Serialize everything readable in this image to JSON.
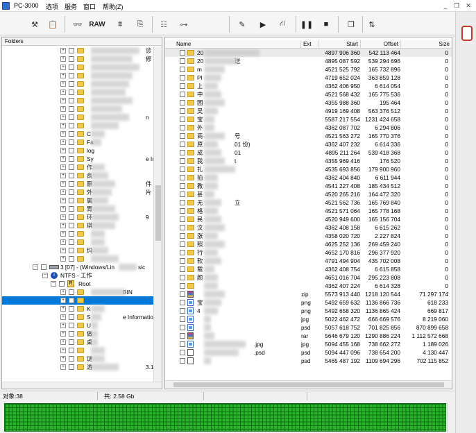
{
  "app": {
    "title": "PC-3000"
  },
  "menu": [
    "选项",
    "服务",
    "窗口",
    "帮助(Z)"
  ],
  "toolbar": {
    "raw_label": "RAW",
    "icons": [
      "tools-icon",
      "clipboard-icon",
      "binoculars-icon",
      "raw-button",
      "stack-icon",
      "export-icon",
      "tree-icon",
      "tree-branch-icon",
      "document-icon",
      "play-icon",
      "network-icon",
      "pause-icon",
      "stop-icon",
      "pages-icon",
      "sort-icon"
    ]
  },
  "left": {
    "header": "Folders",
    "tree": [
      {
        "label": "",
        "suffix": "诊"
      },
      {
        "label": "",
        "suffix": "修"
      },
      {
        "label": "",
        "suffix": ""
      },
      {
        "label": "",
        "suffix": ""
      },
      {
        "label": "",
        "suffix": ""
      },
      {
        "label": "",
        "suffix": ""
      },
      {
        "label": "",
        "suffix": ""
      },
      {
        "label": "",
        "suffix": ""
      },
      {
        "label": "",
        "suffix": "n"
      },
      {
        "label": "",
        "suffix": ""
      },
      {
        "label": "C",
        "suffix": ""
      },
      {
        "label": "Fa",
        "suffix": ""
      },
      {
        "label": "log",
        "suffix": ""
      },
      {
        "label": "Sy",
        "suffix": "e Information"
      },
      {
        "label": "作",
        "suffix": ""
      },
      {
        "label": "俞",
        "suffix": ""
      },
      {
        "label": "原",
        "suffix": "件"
      },
      {
        "label": "外",
        "suffix": "片"
      },
      {
        "label": "属",
        "suffix": ""
      },
      {
        "label": "胃",
        "suffix": ""
      },
      {
        "label": "环",
        "suffix": "9"
      },
      {
        "label": "琪",
        "suffix": ""
      },
      {
        "label": "",
        "suffix": ""
      },
      {
        "label": "",
        "suffix": ""
      },
      {
        "label": "玛",
        "suffix": ""
      },
      {
        "label": "",
        "suffix": ""
      }
    ],
    "partition": "3 [07] - (Windows/Lin",
    "partition_suffix": "sic",
    "fs": "NTFS - 工作",
    "root": "Root",
    "root_icon_letter": "R",
    "after_root": [
      {
        "label": "",
        "suffix": "BIN"
      },
      {
        "label": "",
        "suffix": ""
      },
      {
        "label": "K",
        "suffix": ""
      },
      {
        "label": "S",
        "suffix": "e Information"
      },
      {
        "label": "U",
        "suffix": ""
      },
      {
        "label": "做",
        "suffix": ""
      },
      {
        "label": "桌",
        "suffix": ""
      },
      {
        "label": "",
        "suffix": ""
      },
      {
        "label": "谜",
        "suffix": ""
      },
      {
        "label": "游",
        "suffix": "3.1"
      }
    ]
  },
  "right": {
    "columns": {
      "name": "Name",
      "ext": "Ext",
      "start": "Start",
      "offset": "Offset",
      "size": "Size"
    },
    "rows": [
      {
        "icon": "folder",
        "name": "20",
        "ext": "",
        "start": "4897 906 360",
        "offset": "542 113 464",
        "size": "0"
      },
      {
        "icon": "folder",
        "name": "20",
        "ext": "",
        "start": "4895 087 592",
        "offset": "539 294 696",
        "size": "0",
        "suffix": "送"
      },
      {
        "icon": "folder",
        "name": "m",
        "ext": "",
        "start": "4521 525 792",
        "offset": "165 732 896",
        "size": "0"
      },
      {
        "icon": "folder",
        "name": "Pl",
        "ext": "",
        "start": "4719 652 024",
        "offset": "363 859 128",
        "size": "0"
      },
      {
        "icon": "folder",
        "name": "上",
        "ext": "",
        "start": "4362 406 950",
        "offset": "6 614 054",
        "size": "0"
      },
      {
        "icon": "folder",
        "name": "中",
        "ext": "",
        "start": "4521 568 432",
        "offset": "165 775 536",
        "size": "0"
      },
      {
        "icon": "folder",
        "name": "困",
        "ext": "",
        "start": "4355 988 360",
        "offset": "195 464",
        "size": "0"
      },
      {
        "icon": "folder",
        "name": "吴",
        "ext": "",
        "start": "4919 169 408",
        "offset": "563 376 512",
        "size": "0"
      },
      {
        "icon": "folder",
        "name": "宝",
        "ext": "",
        "start": "5587 217 554",
        "offset": "1231 424 658",
        "size": "0"
      },
      {
        "icon": "folder",
        "name": "外",
        "ext": "",
        "start": "4362 087 702",
        "offset": "6 294 806",
        "size": "0"
      },
      {
        "icon": "folder",
        "name": "商",
        "ext": "",
        "start": "4521 563 272",
        "offset": "165 770 376",
        "size": "0",
        "suffix": "号"
      },
      {
        "icon": "folder",
        "name": "原",
        "ext": "",
        "start": "4362 407 232",
        "offset": "6 614 336",
        "size": "0",
        "suffix": "01       份)"
      },
      {
        "icon": "folder",
        "name": "成",
        "ext": "",
        "start": "4895 211 264",
        "offset": "539 418 368",
        "size": "0",
        "suffix": "01"
      },
      {
        "icon": "folder",
        "name": "我",
        "ext": "",
        "start": "4355 969 416",
        "offset": "176 520",
        "size": "0",
        "suffix": "t"
      },
      {
        "icon": "folder",
        "name": "扎",
        "ext": "",
        "start": "4535 693 856",
        "offset": "179 900 960",
        "size": "0"
      },
      {
        "icon": "folder",
        "name": "拍",
        "ext": "",
        "start": "4362 404 840",
        "offset": "6 611 944",
        "size": "0"
      },
      {
        "icon": "folder",
        "name": "教",
        "ext": "",
        "start": "4541 227 408",
        "offset": "185 434 512",
        "size": "0"
      },
      {
        "icon": "folder",
        "name": "甚",
        "ext": "",
        "start": "4520 265 216",
        "offset": "164 472 320",
        "size": "0"
      },
      {
        "icon": "folder",
        "name": "无",
        "ext": "",
        "start": "4521 562 736",
        "offset": "165 769 840",
        "size": "0",
        "suffix": "立"
      },
      {
        "icon": "folder",
        "name": "格",
        "ext": "",
        "start": "4521 571 064",
        "offset": "165 778 168",
        "size": "0"
      },
      {
        "icon": "folder",
        "name": "民",
        "ext": "",
        "start": "4520 949 600",
        "offset": "165 156 704",
        "size": "0"
      },
      {
        "icon": "folder",
        "name": "汶",
        "ext": "",
        "start": "4362 408 158",
        "offset": "6 615 262",
        "size": "0"
      },
      {
        "icon": "folder",
        "name": "涨",
        "ext": "",
        "start": "4358 020 720",
        "offset": "2 227 824",
        "size": "0"
      },
      {
        "icon": "folder",
        "name": "照",
        "ext": "",
        "start": "4625 252 136",
        "offset": "269 459 240",
        "size": "0"
      },
      {
        "icon": "folder",
        "name": "行",
        "ext": "",
        "start": "4652 170 816",
        "offset": "296 377 920",
        "size": "0"
      },
      {
        "icon": "folder",
        "name": "软",
        "ext": "",
        "start": "4791 494 904",
        "offset": "435 702 008",
        "size": "0"
      },
      {
        "icon": "folder",
        "name": "载",
        "ext": "",
        "start": "4362 408 754",
        "offset": "6 615 858",
        "size": "0"
      },
      {
        "icon": "folder",
        "name": "颜",
        "ext": "",
        "start": "4651 016 704",
        "offset": "295 223 808",
        "size": "0"
      },
      {
        "icon": "folder",
        "name": "",
        "ext": "",
        "start": "4362 407 224",
        "offset": "6 614 328",
        "size": "0"
      },
      {
        "icon": "rar",
        "name": "",
        "ext": "zip",
        "start": "5573 913 440",
        "offset": "1218 120 544",
        "size": "71 297 174"
      },
      {
        "icon": "image",
        "name": "宝",
        "ext": "png",
        "start": "5492 659 632",
        "offset": "1136 866 736",
        "size": "618 233"
      },
      {
        "icon": "image",
        "name": "4",
        "ext": "png",
        "start": "5492 658 320",
        "offset": "1136 865 424",
        "size": "669 817"
      },
      {
        "icon": "image",
        "name": "",
        "ext": "jpg",
        "start": "5022 462 472",
        "offset": "666 669 576",
        "size": "8 219 060"
      },
      {
        "icon": "image",
        "name": "",
        "ext": "psd",
        "start": "5057 618 752",
        "offset": "701 825 856",
        "size": "870 899 658"
      },
      {
        "icon": "rar",
        "name": "",
        "ext": "rar",
        "start": "5646 679 120",
        "offset": "1290 886 224",
        "size": "1 112 572 668"
      },
      {
        "icon": "image",
        "name": "",
        "ext": "jpg",
        "start": "5094 455 168",
        "offset": "738 662 272",
        "size": "1 189 026",
        "suffix": ".jpg"
      },
      {
        "icon": "doc",
        "name": "",
        "ext": "psd",
        "start": "5094 447 096",
        "offset": "738 654 200",
        "size": "4 130 447",
        "suffix": ".psd"
      },
      {
        "icon": "doc",
        "name": "",
        "ext": "psd",
        "start": "5465 487 192",
        "offset": "1109 694 296",
        "size": "702 115 852"
      }
    ]
  },
  "status": {
    "objects": "对象:38",
    "total": "共:  2.58 Gb"
  }
}
